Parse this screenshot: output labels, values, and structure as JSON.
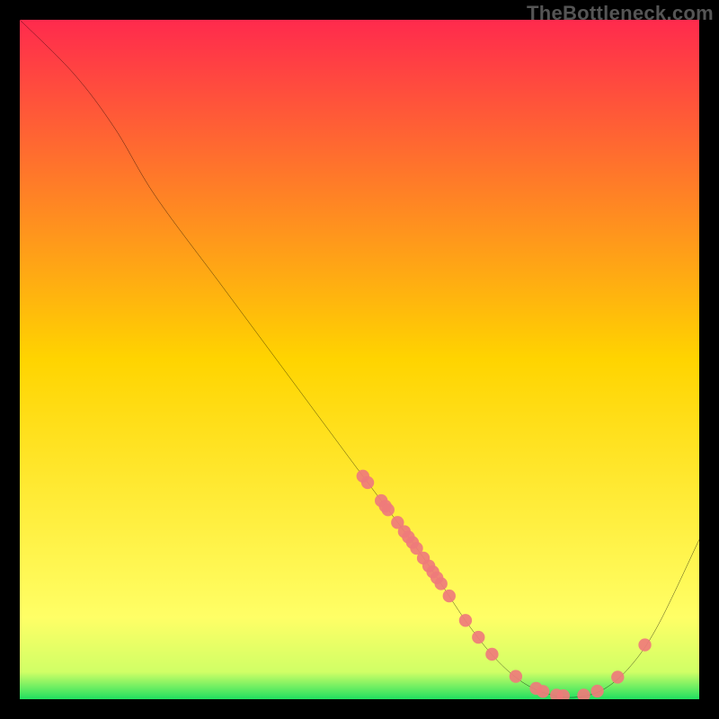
{
  "attribution": "TheBottleneck.com",
  "chart_data": {
    "type": "line",
    "title": "",
    "xlabel": "",
    "ylabel": "",
    "xlim": [
      0,
      100
    ],
    "ylim": [
      0,
      100
    ],
    "background_gradient_stops": [
      {
        "t": 0.0,
        "color": "#ff2a4d"
      },
      {
        "t": 0.5,
        "color": "#ffd400"
      },
      {
        "t": 0.88,
        "color": "#ffff66"
      },
      {
        "t": 0.96,
        "color": "#d0ff66"
      },
      {
        "t": 1.0,
        "color": "#20e060"
      }
    ],
    "series": [
      {
        "name": "curve",
        "color": "#000000",
        "points": [
          {
            "x": 0.0,
            "y": 100.0
          },
          {
            "x": 8.0,
            "y": 92.0
          },
          {
            "x": 14.0,
            "y": 84.0
          },
          {
            "x": 20.0,
            "y": 74.0
          },
          {
            "x": 30.0,
            "y": 60.5
          },
          {
            "x": 40.0,
            "y": 47.0
          },
          {
            "x": 50.0,
            "y": 33.5
          },
          {
            "x": 58.0,
            "y": 22.8
          },
          {
            "x": 62.0,
            "y": 17.0
          },
          {
            "x": 66.0,
            "y": 11.0
          },
          {
            "x": 70.0,
            "y": 6.0
          },
          {
            "x": 74.0,
            "y": 2.5
          },
          {
            "x": 78.0,
            "y": 0.7
          },
          {
            "x": 82.0,
            "y": 0.3
          },
          {
            "x": 86.0,
            "y": 1.5
          },
          {
            "x": 90.0,
            "y": 5.0
          },
          {
            "x": 94.0,
            "y": 11.0
          },
          {
            "x": 100.0,
            "y": 23.5
          }
        ]
      }
    ],
    "scatter": {
      "color": "#ef7b7b",
      "points_on_curve_x": [
        50.5,
        51.2,
        53.2,
        53.8,
        54.2,
        55.6,
        56.6,
        57.2,
        57.8,
        58.4,
        59.4,
        60.2,
        60.8,
        61.4,
        62.0,
        63.2,
        65.6,
        67.5,
        69.5,
        73.0,
        76.0,
        77.0,
        79.0,
        80.0,
        83.0,
        85.0,
        88.0,
        92.0
      ]
    }
  }
}
